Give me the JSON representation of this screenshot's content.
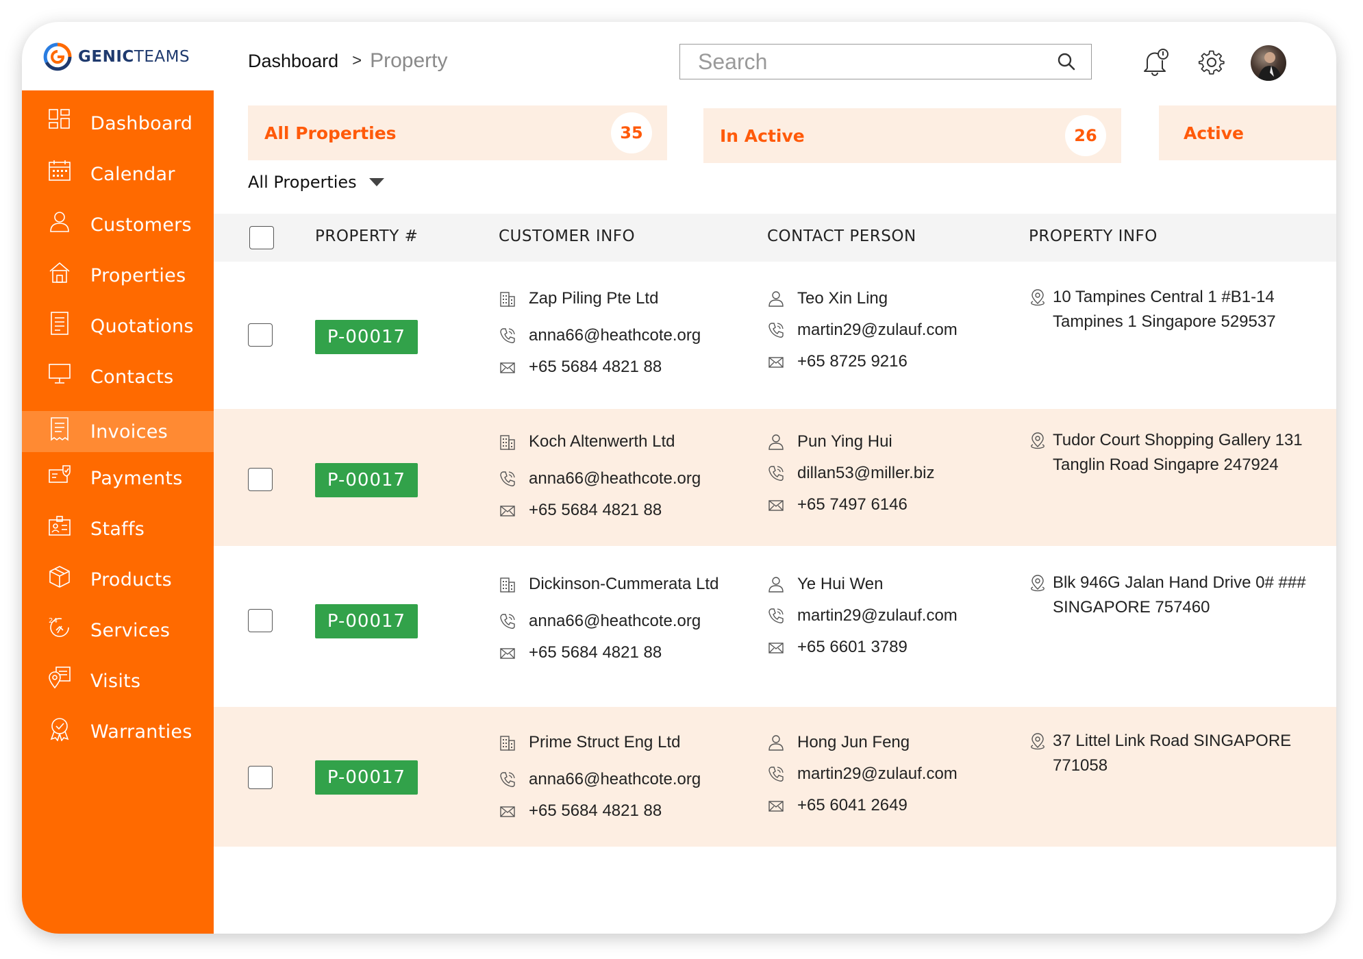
{
  "brand": {
    "name_bold": "GENIC",
    "name_thin": "TEAMS"
  },
  "breadcrumb": {
    "home": "Dashboard",
    "separator": ">",
    "current": "Property"
  },
  "search": {
    "placeholder": "Search"
  },
  "colors": {
    "accent": "#ff6a00",
    "accent_light": "#fdeee2",
    "badge": "#32a24a"
  },
  "sidebar": {
    "items": [
      {
        "label": "Dashboard",
        "icon": "dashboard-icon"
      },
      {
        "label": "Calendar",
        "icon": "calendar-icon"
      },
      {
        "label": "Customers",
        "icon": "user-icon"
      },
      {
        "label": "Properties",
        "icon": "house-icon"
      },
      {
        "label": "Quotations",
        "icon": "document-icon"
      },
      {
        "label": "Contacts",
        "icon": "monitor-icon"
      },
      {
        "label": "Invoices",
        "icon": "receipt-icon",
        "active": true
      },
      {
        "label": "Payments",
        "icon": "payment-icon"
      },
      {
        "label": "Staffs",
        "icon": "id-card-icon"
      },
      {
        "label": "Products",
        "icon": "box-icon"
      },
      {
        "label": "Services",
        "icon": "service-24-icon"
      },
      {
        "label": "Visits",
        "icon": "map-pin-icon"
      },
      {
        "label": "Warranties",
        "icon": "award-icon"
      }
    ]
  },
  "tabs": [
    {
      "label": "All Properties",
      "count": "35"
    },
    {
      "label": "In Active",
      "count": "26"
    },
    {
      "label": "Active"
    }
  ],
  "filter": {
    "label": "All Properties"
  },
  "table": {
    "headers": {
      "property": "PROPERTY #",
      "customer": "CUSTOMER INFO",
      "contact": "CONTACT PERSON",
      "info": "PROPERTY INFO"
    },
    "rows": [
      {
        "property_id": "P-00017",
        "customer": {
          "company": "Zap Piling Pte Ltd",
          "email": "anna66@heathcote.org",
          "phone": "+65 5684 4821 88"
        },
        "contact": {
          "name": "Teo Xin Ling",
          "email": "martin29@zulauf.com",
          "phone": "+65 8725 9216"
        },
        "address": [
          "10 Tampines Central 1 #B1-14",
          "Tampines 1 Singapore 529537"
        ]
      },
      {
        "property_id": "P-00017",
        "customer": {
          "company": "Koch Altenwerth Ltd",
          "email": "anna66@heathcote.org",
          "phone": "+65 5684 4821 88"
        },
        "contact": {
          "name": "Pun Ying Hui",
          "email": "dillan53@miller.biz",
          "phone": "+65 7497 6146"
        },
        "address": [
          "Tudor Court Shopping Gallery 131",
          "Tanglin Road Singapre 247924"
        ]
      },
      {
        "property_id": "P-00017",
        "customer": {
          "company": "Dickinson-Cummerata Ltd",
          "email": "anna66@heathcote.org",
          "phone": "+65 5684 4821 88"
        },
        "contact": {
          "name": "Ye Hui Wen",
          "email": "martin29@zulauf.com",
          "phone": "+65 6601 3789"
        },
        "address": [
          "Blk 946G Jalan Hand Drive 0# ###",
          "SINGAPORE 757460"
        ]
      },
      {
        "property_id": "P-00017",
        "customer": {
          "company": "Prime Struct Eng Ltd",
          "email": "anna66@heathcote.org",
          "phone": "+65 5684 4821 88"
        },
        "contact": {
          "name": "Hong Jun Feng",
          "email": "martin29@zulauf.com",
          "phone": "+65 6041 2649"
        },
        "address": [
          "37 Littel Link Road SINGAPORE",
          "771058"
        ]
      }
    ]
  }
}
